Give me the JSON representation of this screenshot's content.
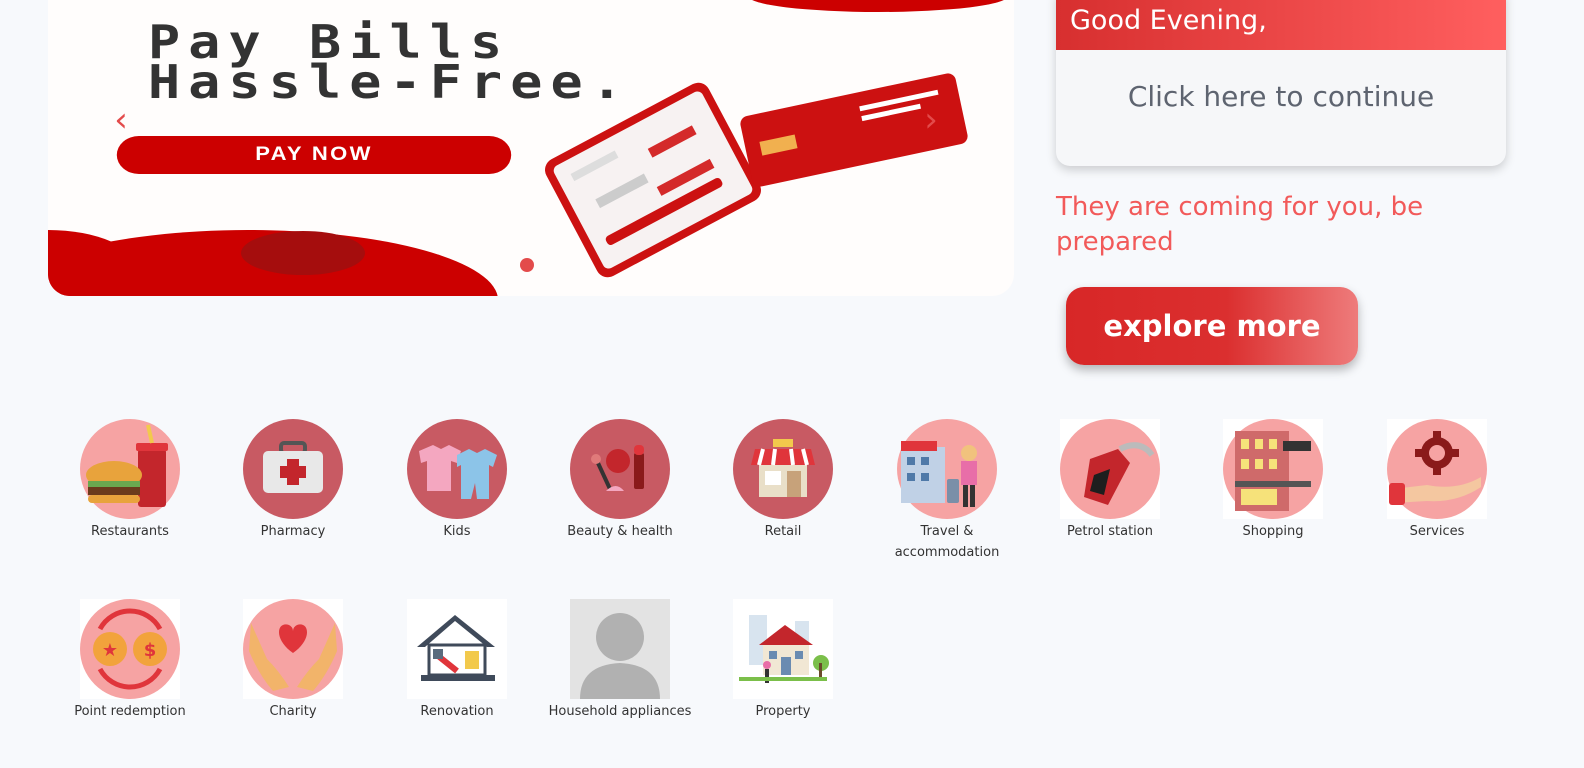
{
  "banner": {
    "title_line1": "Pay Bills",
    "title_line2": "Hassle-Free.",
    "cta_label": "PAY NOW",
    "prev_arrow": "‹",
    "next_arrow": "›"
  },
  "greeting": {
    "header": "Good Evening,",
    "link": "Click here to continue"
  },
  "tagline": "They are coming for you, be prepared",
  "explore_label": "explore more",
  "colors": {
    "accent": "#e34b4b",
    "brand_red": "#cc0000",
    "circle_pink": "#f6a3a3",
    "circle_rose": "#c85a63"
  },
  "categories": [
    {
      "label": "Restaurants",
      "icon": "burger-drink-icon"
    },
    {
      "label": "Pharmacy",
      "icon": "first-aid-kit-icon"
    },
    {
      "label": "Kids",
      "icon": "baby-clothes-icon"
    },
    {
      "label": "Beauty & health",
      "icon": "cosmetics-icon"
    },
    {
      "label": "Retail",
      "icon": "storefront-icon"
    },
    {
      "label": "Travel & accommodation",
      "icon": "hotel-traveler-icon"
    },
    {
      "label": "Petrol station",
      "icon": "fuel-nozzle-icon"
    },
    {
      "label": "Shopping",
      "icon": "shopping-mall-icon"
    },
    {
      "label": "Services",
      "icon": "gear-hand-icon"
    },
    {
      "label": "Point redemption",
      "icon": "coin-exchange-icon"
    },
    {
      "label": "Charity",
      "icon": "heart-hands-icon"
    },
    {
      "label": "Renovation",
      "icon": "house-paint-icon"
    },
    {
      "label": "Household appliances",
      "icon": "user-placeholder-icon"
    },
    {
      "label": "Property",
      "icon": "property-house-icon"
    }
  ]
}
